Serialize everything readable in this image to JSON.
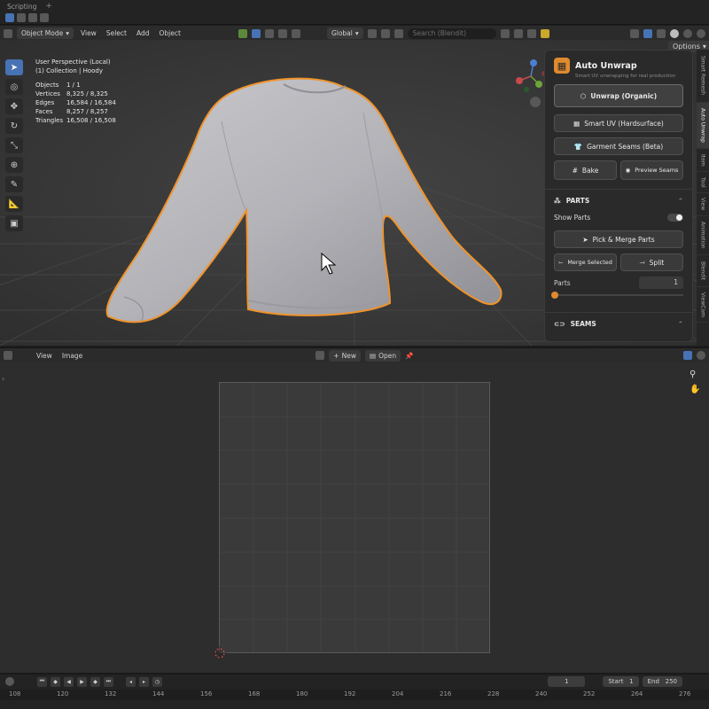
{
  "tabs": {
    "scripting": "Scripting",
    "plus": "+"
  },
  "header3d": {
    "mode": "Object Mode",
    "menus": [
      "View",
      "Select",
      "Add",
      "Object"
    ],
    "orientation": "Global",
    "search_placeholder": "Search (Blendit)",
    "options": "Options"
  },
  "viewport": {
    "view_name": "User Perspective (Local)",
    "collection": "(1) Collection | Hoody",
    "stats": [
      {
        "label": "Objects",
        "value": "1 / 1"
      },
      {
        "label": "Vertices",
        "value": "8,325 / 8,325"
      },
      {
        "label": "Edges",
        "value": "16,584 / 16,584"
      },
      {
        "label": "Faces",
        "value": "8,257 / 8,257"
      },
      {
        "label": "Triangles",
        "value": "16,508 / 16,508"
      }
    ]
  },
  "panel": {
    "title": "Auto Unwrap",
    "subtitle": "Smart UV unwrapping for real production",
    "unwrap_organic": "Unwrap (Organic)",
    "smart_uv": "Smart UV (Hardsurface)",
    "garment_seams": "Garment Seams (Beta)",
    "bake": "Bake",
    "preview_seams": "Preview Seams",
    "parts_section": "PARTS",
    "show_parts": "Show Parts",
    "pick_merge": "Pick & Merge Parts",
    "merge_selected": "Merge Selected",
    "split": "Split",
    "parts_label": "Parts",
    "parts_value": "1",
    "seams_section": "SEAMS",
    "accent": "#e08a2e"
  },
  "side_tabs": [
    "Smart Remesh",
    "Auto Unwrap",
    "Item",
    "Tool",
    "View",
    "Animation",
    "Blendit",
    "ViewCam"
  ],
  "uv_header": {
    "menus": [
      "View",
      "Image"
    ],
    "new": "New",
    "open": "Open"
  },
  "timeline": {
    "current_frame": "1",
    "start_label": "Start",
    "start": "1",
    "end_label": "End",
    "end": "250",
    "ruler": [
      "108",
      "120",
      "132",
      "144",
      "156",
      "168",
      "180",
      "192",
      "204",
      "216",
      "228",
      "240",
      "252",
      "264",
      "276"
    ]
  }
}
